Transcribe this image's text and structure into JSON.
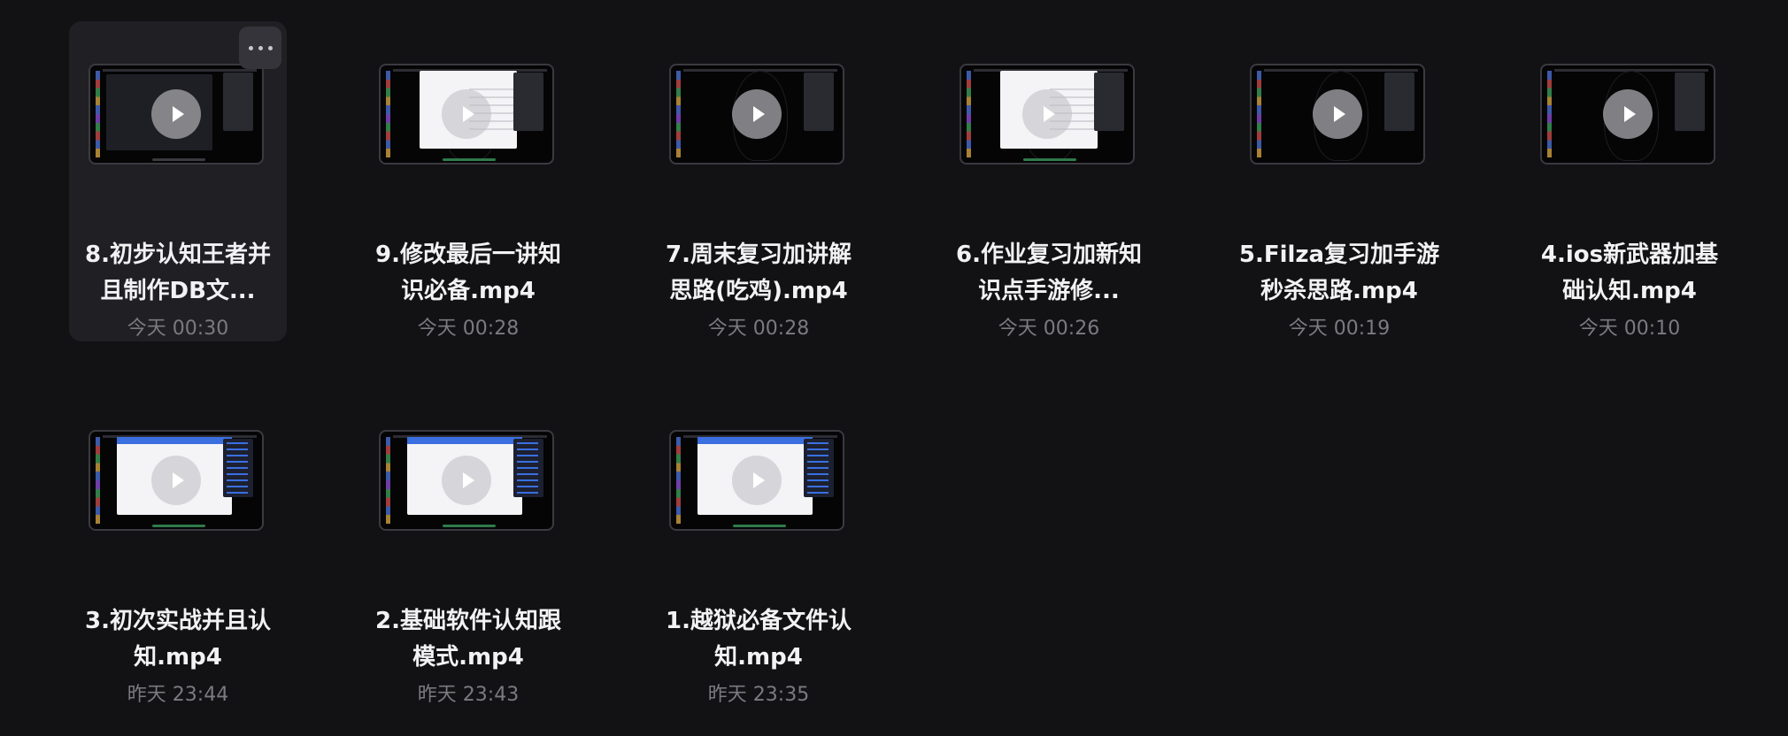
{
  "files": [
    {
      "title_lines": [
        "8.初步认知王者并",
        "且制作DB文..."
      ],
      "date": "今天 00:30",
      "selected": true,
      "thumb_style": "dark-window"
    },
    {
      "title_lines": [
        "9.修改最后一讲知",
        "识必备.mp4"
      ],
      "date": "今天 00:28",
      "selected": false,
      "thumb_style": "light-window"
    },
    {
      "title_lines": [
        "7.周末复习加讲解",
        "思路(吃鸡).mp4"
      ],
      "date": "今天 00:28",
      "selected": false,
      "thumb_style": "desktop"
    },
    {
      "title_lines": [
        "6.作业复习加新知",
        "识点手游修..."
      ],
      "date": "今天 00:26",
      "selected": false,
      "thumb_style": "light-window"
    },
    {
      "title_lines": [
        "5.Filza复习加手游",
        "秒杀思路.mp4"
      ],
      "date": "今天 00:19",
      "selected": false,
      "thumb_style": "desktop"
    },
    {
      "title_lines": [
        "4.ios新武器加基",
        "础认知.mp4"
      ],
      "date": "今天 00:10",
      "selected": false,
      "thumb_style": "desktop"
    },
    {
      "title_lines": [
        "3.初次实战并且认",
        "知.mp4"
      ],
      "date": "昨天 23:44",
      "selected": false,
      "thumb_style": "light-window-wide"
    },
    {
      "title_lines": [
        "2.基础软件认知跟",
        "模式.mp4"
      ],
      "date": "昨天 23:43",
      "selected": false,
      "thumb_style": "light-window-wide"
    },
    {
      "title_lines": [
        "1.越狱必备文件认",
        "知.mp4"
      ],
      "date": "昨天 23:35",
      "selected": false,
      "thumb_style": "light-window-wide"
    }
  ],
  "icons": {
    "more": "more-horizontal-icon",
    "play": "play-icon"
  },
  "colors": {
    "background": "#121215",
    "selected_tile": "#202024",
    "date_text": "#7a7a80"
  }
}
